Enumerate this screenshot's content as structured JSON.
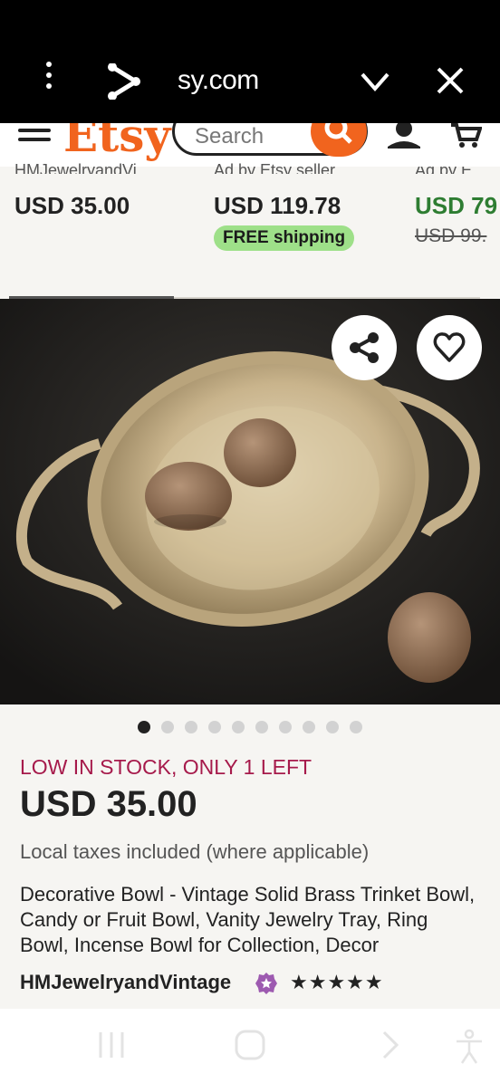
{
  "browser": {
    "url_fragment": "sy.com"
  },
  "etsy": {
    "logo": "Etsy",
    "search_placeholder": "Search"
  },
  "products": [
    {
      "cut_text": "HMJewelryandVi...",
      "price": "USD 35.00"
    },
    {
      "cut_text": "Ad by Etsy seller",
      "price": "USD 119.78",
      "badge": "FREE shipping"
    },
    {
      "cut_text": "Ad by E",
      "price": "USD 79",
      "original": "USD 99."
    }
  ],
  "pager": {
    "count": 10,
    "active": 0
  },
  "listing": {
    "stock": "LOW IN STOCK, ONLY 1 LEFT",
    "price": "USD 35.00",
    "tax": "Local taxes included (where applicable)",
    "title": "Decorative Bowl - Vintage Solid Brass Trinket Bowl, Candy or Fruit Bowl, Vanity Jewelry Tray, Ring Bowl, Incense Bowl for Collection, Decor",
    "shop": "HMJewelryandVintage",
    "stars": "★★★★★",
    "rating": 5
  },
  "colors": {
    "brand": "#f1641e",
    "stock": "#a61a4b",
    "sale": "#2e7d32",
    "badge": "#9ee089"
  },
  "icons": [
    "menu-icon",
    "share-icon",
    "chevron-down-icon",
    "close-icon",
    "search-icon",
    "account-icon",
    "cart-icon",
    "heart-icon",
    "star-seller-icon",
    "recents-icon",
    "home-icon",
    "back-icon",
    "accessibility-icon"
  ]
}
